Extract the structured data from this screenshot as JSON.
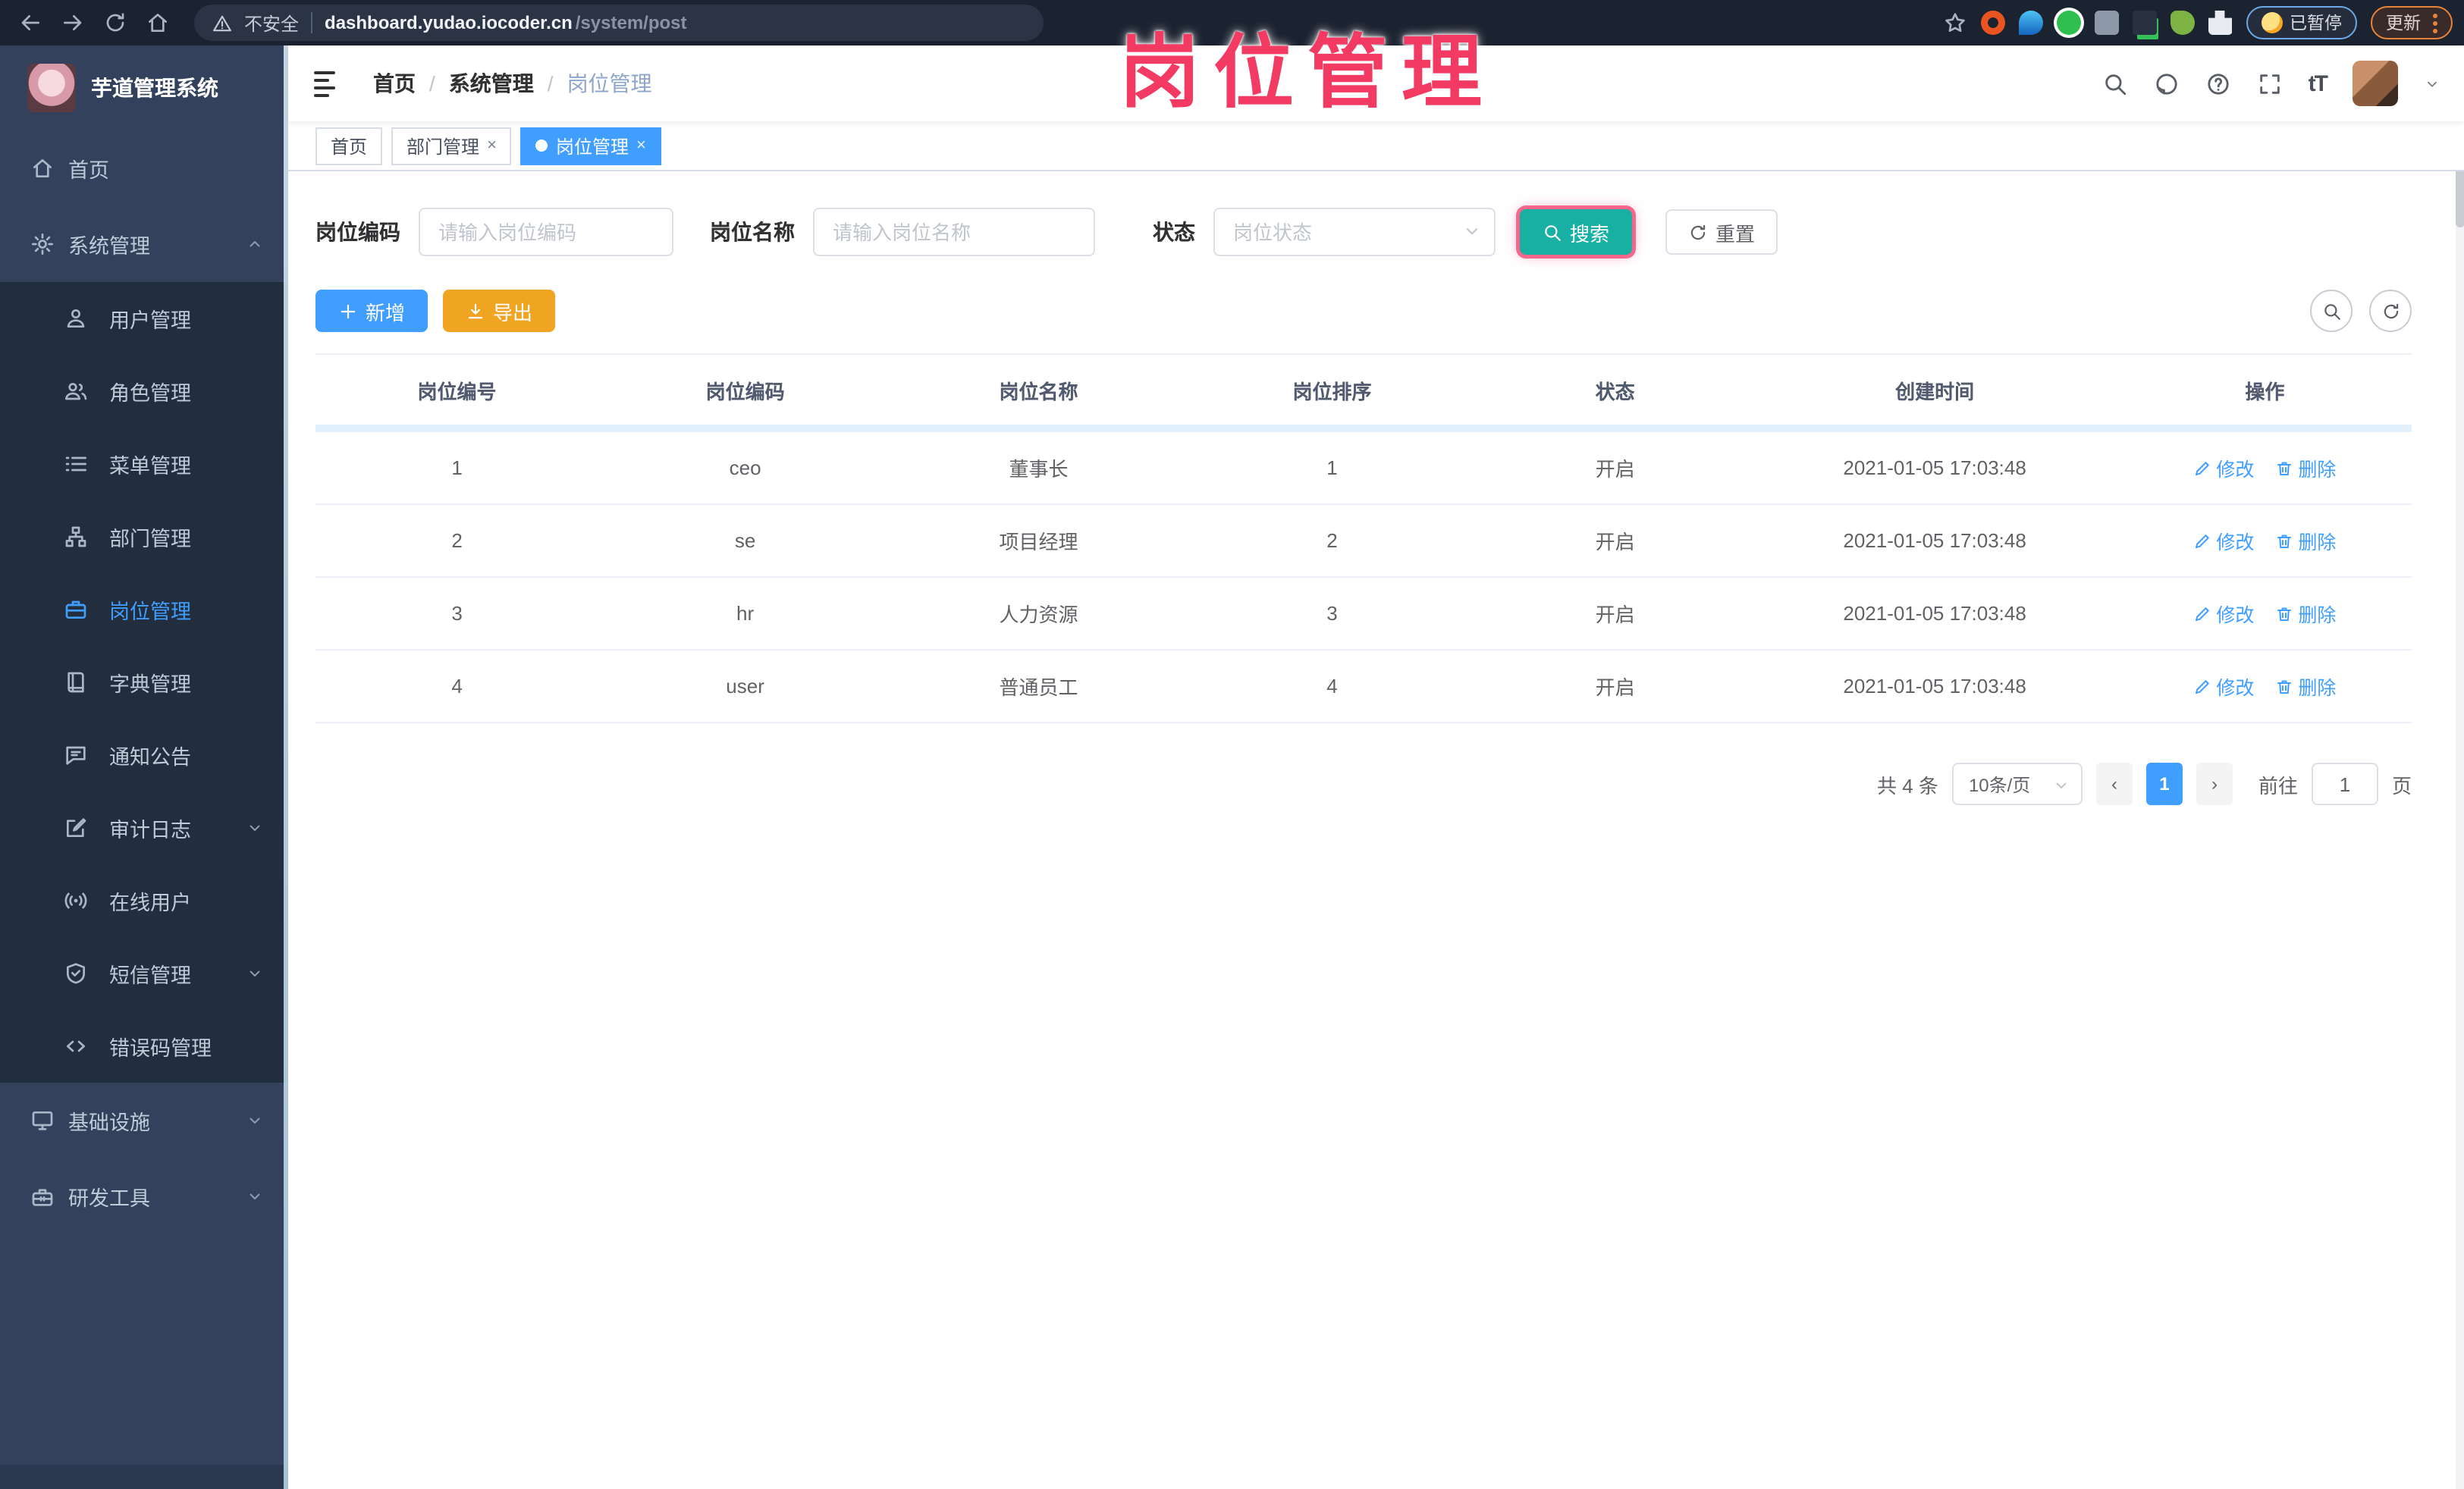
{
  "browser": {
    "security_label": "不安全",
    "url_host": "dashboard.yudao.iocoder.cn",
    "url_path": "/system/post",
    "paused_label": "已暂停",
    "update_label": "更新"
  },
  "annotation": {
    "text": "岗位管理"
  },
  "sidebar": {
    "logo_title": "芋道管理系统",
    "items": [
      {
        "label": "首页"
      },
      {
        "label": "系统管理"
      },
      {
        "label": "用户管理"
      },
      {
        "label": "角色管理"
      },
      {
        "label": "菜单管理"
      },
      {
        "label": "部门管理"
      },
      {
        "label": "岗位管理"
      },
      {
        "label": "字典管理"
      },
      {
        "label": "通知公告"
      },
      {
        "label": "审计日志"
      },
      {
        "label": "在线用户"
      },
      {
        "label": "短信管理"
      },
      {
        "label": "错误码管理"
      },
      {
        "label": "基础设施"
      },
      {
        "label": "研发工具"
      }
    ]
  },
  "navbar": {
    "breadcrumb": [
      {
        "label": "首页"
      },
      {
        "label": "系统管理"
      },
      {
        "label": "岗位管理"
      }
    ],
    "font_size_icon": "tT"
  },
  "tabs": [
    {
      "label": "首页"
    },
    {
      "label": "部门管理"
    },
    {
      "label": "岗位管理"
    }
  ],
  "filters": {
    "code_label": "岗位编码",
    "code_placeholder": "请输入岗位编码",
    "name_label": "岗位名称",
    "name_placeholder": "请输入岗位名称",
    "status_label": "状态",
    "status_placeholder": "岗位状态",
    "search_label": "搜索",
    "reset_label": "重置"
  },
  "toolbar": {
    "add_label": "新增",
    "export_label": "导出"
  },
  "table": {
    "headers": [
      "岗位编号",
      "岗位编码",
      "岗位名称",
      "岗位排序",
      "状态",
      "创建时间",
      "操作"
    ],
    "actions": {
      "edit": "修改",
      "delete": "删除"
    },
    "rows": [
      {
        "id": "1",
        "code": "ceo",
        "name": "董事长",
        "sort": "1",
        "status": "开启",
        "time": "2021-01-05 17:03:48"
      },
      {
        "id": "2",
        "code": "se",
        "name": "项目经理",
        "sort": "2",
        "status": "开启",
        "time": "2021-01-05 17:03:48"
      },
      {
        "id": "3",
        "code": "hr",
        "name": "人力资源",
        "sort": "3",
        "status": "开启",
        "time": "2021-01-05 17:03:48"
      },
      {
        "id": "4",
        "code": "user",
        "name": "普通员工",
        "sort": "4",
        "status": "开启",
        "time": "2021-01-05 17:03:48"
      }
    ]
  },
  "pagination": {
    "total": "共 4 条",
    "page_size": "10条/页",
    "current_page": "1",
    "goto_prefix": "前往",
    "goto_value": "1",
    "goto_suffix": "页"
  },
  "colors": {
    "primary": "#409EFF",
    "search_teal": "#18b0a2",
    "export_orange": "#efa422",
    "annotation_pink": "#f23a62",
    "sidebar_bg": "#33415c",
    "submenu_bg": "#222d3d"
  }
}
